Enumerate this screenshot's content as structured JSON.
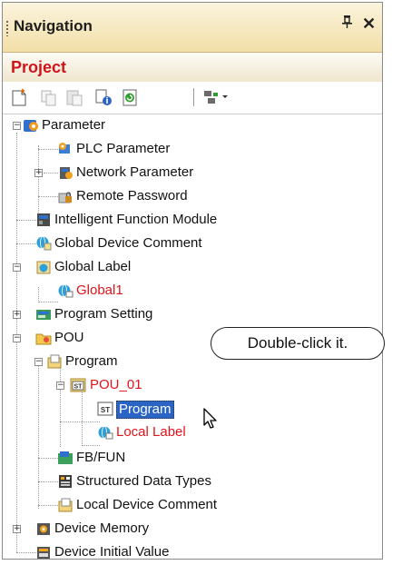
{
  "panel": {
    "title": "Navigation",
    "pin": "չ",
    "close": "✕"
  },
  "project": {
    "label": "Project"
  },
  "toolbar": {
    "icons": [
      "new-data-icon",
      "copy-icon",
      "paste-icon",
      "properties-icon",
      "refresh-icon",
      "filter-dropdown-icon"
    ]
  },
  "colors": {
    "title_bg": "#f2dfa8",
    "project_text": "#d0141b",
    "red_item": "#e0141b",
    "selection": "#2a64c4"
  },
  "tree": [
    {
      "label": "Parameter",
      "expander": "−",
      "icon": "parameter-icon"
    },
    {
      "label": "PLC Parameter",
      "icon": "plc-parameter-icon"
    },
    {
      "label": "Network Parameter",
      "expander": "+",
      "icon": "network-parameter-icon"
    },
    {
      "label": "Remote Password",
      "icon": "remote-password-icon"
    },
    {
      "label": "Intelligent Function Module",
      "icon": "intelligent-module-icon"
    },
    {
      "label": "Global Device Comment",
      "icon": "device-comment-icon"
    },
    {
      "label": "Global Label",
      "expander": "−",
      "icon": "global-label-icon"
    },
    {
      "label": "Global1",
      "icon": "global-label-item-icon"
    },
    {
      "label": "Program Setting",
      "expander": "+",
      "icon": "program-setting-icon"
    },
    {
      "label": "POU",
      "expander": "−",
      "icon": "pou-folder-icon"
    },
    {
      "label": "Program",
      "expander": "−",
      "icon": "program-folder-icon"
    },
    {
      "label": "POU_01",
      "expander": "−",
      "icon": "st-program-icon",
      "st": "ST"
    },
    {
      "label": "Program",
      "icon": "st-body-icon",
      "st": "ST"
    },
    {
      "label": "Local Label",
      "icon": "local-label-icon"
    },
    {
      "label": "FB/FUN",
      "icon": "fb-fun-icon"
    },
    {
      "label": "Structured Data Types",
      "icon": "structured-data-icon"
    },
    {
      "label": "Local Device Comment",
      "icon": "local-device-comment-icon"
    },
    {
      "label": "Device Memory",
      "expander": "+",
      "icon": "device-memory-icon"
    },
    {
      "label": "Device Initial Value",
      "icon": "device-initial-value-icon"
    }
  ],
  "callout": {
    "text": "Double-click it."
  }
}
